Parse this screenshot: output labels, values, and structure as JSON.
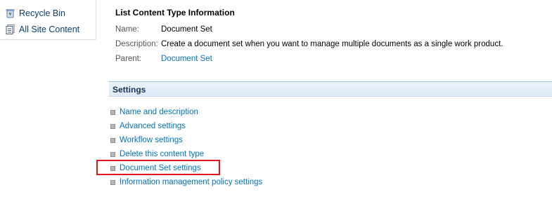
{
  "left_nav": {
    "items": [
      {
        "label": "Recycle Bin",
        "icon": "recycle-bin-icon"
      },
      {
        "label": "All Site Content",
        "icon": "site-content-icon"
      }
    ]
  },
  "info": {
    "title": "List Content Type Information",
    "name_label": "Name:",
    "name_value": "Document Set",
    "description_label": "Description:",
    "description_value": "Create a document set when you want to manage multiple documents as a single work product.",
    "parent_label": "Parent:",
    "parent_value": "Document Set"
  },
  "settings": {
    "header": "Settings",
    "links": [
      "Name and description",
      "Advanced settings",
      "Workflow settings",
      "Delete this content type",
      "Document Set settings",
      "Information management policy settings"
    ],
    "highlighted_index": 4
  },
  "colors": {
    "link": "#0072bc",
    "highlight_border": "#e0141e",
    "header_bg": "#e4eef9"
  }
}
